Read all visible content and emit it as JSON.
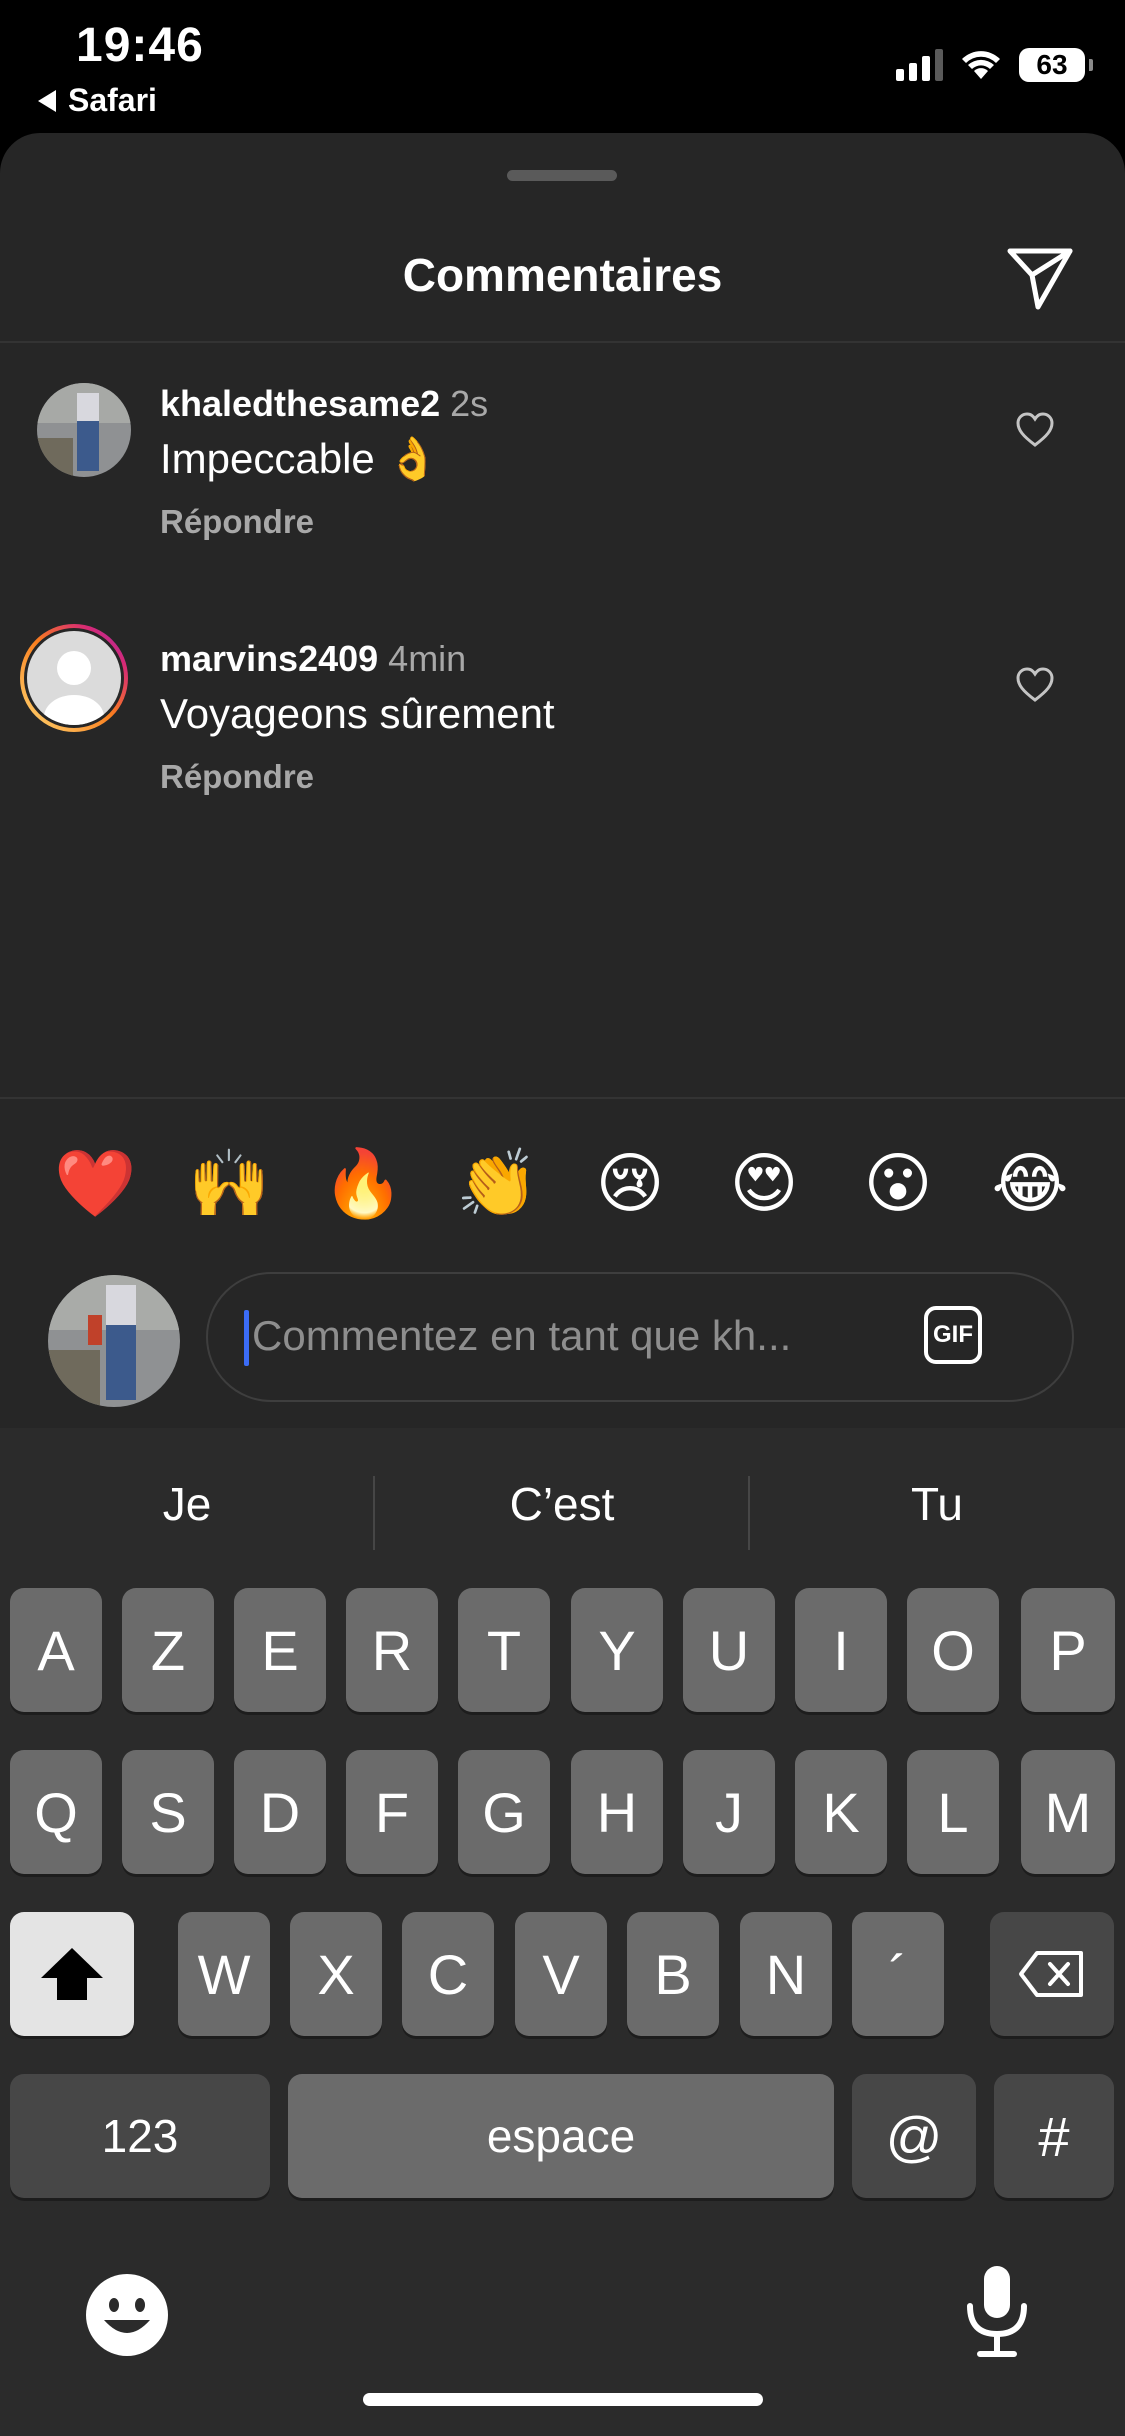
{
  "status_bar": {
    "time": "19:46",
    "back_app": "Safari",
    "battery": "63"
  },
  "header": {
    "title": "Commentaires"
  },
  "comments": [
    {
      "username": "khaledthesame2",
      "time_ago": "2s",
      "text": "Impeccable 👌",
      "reply_label": "Répondre"
    },
    {
      "username": "marvins2409",
      "time_ago": "4min",
      "text": "Voyageons sûrement",
      "reply_label": "Répondre"
    }
  ],
  "quick_emojis": [
    "❤️",
    "🙌",
    "🔥",
    "👏",
    "😢",
    "😍",
    "😮",
    "😂"
  ],
  "comment_input": {
    "placeholder": "Commentez en tant que kh...",
    "gif_label": "GIF"
  },
  "keyboard": {
    "suggestions": [
      "Je",
      "C’est",
      "Tu"
    ],
    "row1": [
      "A",
      "Z",
      "E",
      "R",
      "T",
      "Y",
      "U",
      "I",
      "O",
      "P"
    ],
    "row2": [
      "Q",
      "S",
      "D",
      "F",
      "G",
      "H",
      "J",
      "K",
      "L",
      "M"
    ],
    "row3": [
      "W",
      "X",
      "C",
      "V",
      "B",
      "N",
      "´"
    ],
    "numbers_label": "123",
    "space_label": "espace",
    "at_label": "@",
    "hash_label": "#"
  }
}
